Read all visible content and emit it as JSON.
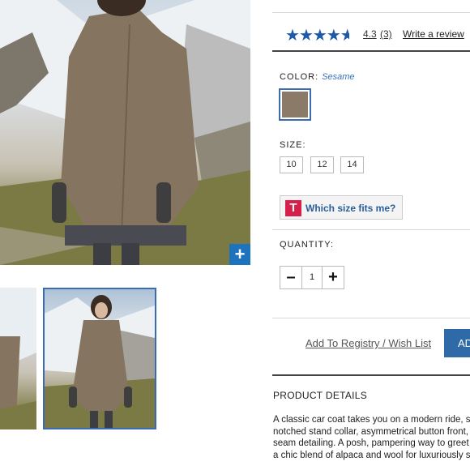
{
  "images": {
    "main_alt": "Woman in sesame wool car coat on snowy mountainside",
    "zoom_label": "+"
  },
  "rating": {
    "stars": "★★★★★",
    "value": 4.3,
    "value_text": "4.3",
    "count_text": "(3)",
    "write_review": "Write a review"
  },
  "color": {
    "label": "COLOR:",
    "selected": "Sesame",
    "swatch_hex": "#8a7a67"
  },
  "size": {
    "label": "SIZE:",
    "options": [
      "10",
      "12",
      "14"
    ]
  },
  "fit": {
    "logo": "T",
    "label": "Which size fits me?"
  },
  "quantity": {
    "label": "QUANTITY:",
    "minus": "–",
    "value": "1",
    "plus": "+"
  },
  "actions": {
    "registry": "Add To Registry / Wish List",
    "add_to_bag": "AD"
  },
  "details": {
    "heading": "PRODUCT DETAILS",
    "lines": [
      "A classic car coat takes you on a modern ride, sp",
      "notched stand collar, asymmetrical button front, s",
      "seam detailing. A posh, pampering way to greet",
      "a chic blend of alpaca and wool for luxuriously s"
    ]
  },
  "colors": {
    "accent": "#1e73be",
    "link": "#3a72b8",
    "brand_logo": "#d61f4b"
  }
}
